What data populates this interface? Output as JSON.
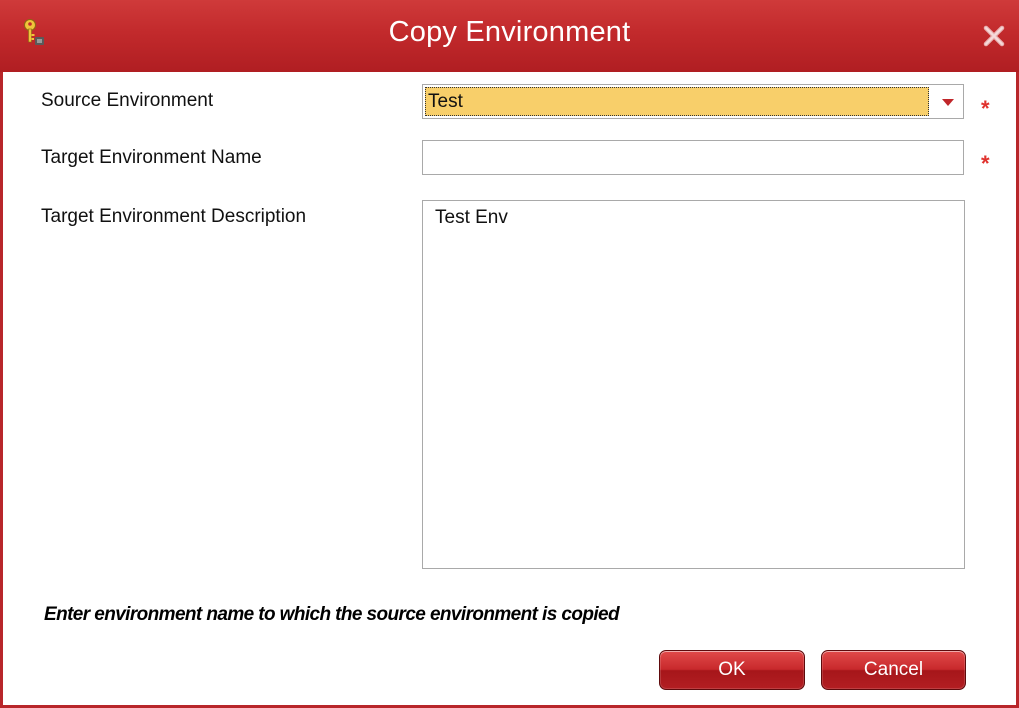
{
  "window": {
    "title": "Copy Environment",
    "accent_color": "#c22a2c",
    "app_icon": "key-icon",
    "close_icon": "close-icon"
  },
  "form": {
    "source_environment": {
      "label": "Source Environment",
      "value": "Test",
      "required_marker": "*"
    },
    "target_name": {
      "label": "Target Environment Name",
      "value": "",
      "required_marker": "*"
    },
    "target_description": {
      "label": "Target Environment Description",
      "value": "Test Env"
    }
  },
  "hint": "Enter environment name to which the source environment is copied",
  "buttons": {
    "ok_label": "OK",
    "cancel_label": "Cancel"
  }
}
